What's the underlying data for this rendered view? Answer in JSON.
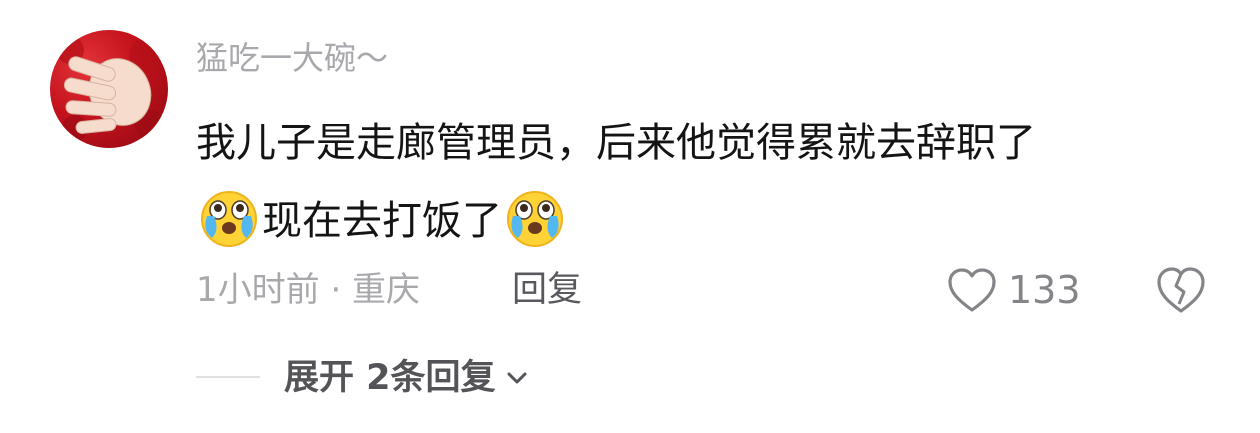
{
  "comment": {
    "username": "猛吃一大碗～",
    "text_line1": "我儿子是走廊管理员，后来他觉得累就去辞职了",
    "text_line2": "现在去打饭了",
    "emoji_icon": "crying-face-emoji",
    "time_location": "1小时前 · 重庆",
    "reply_label": "回复",
    "like_count": "133",
    "expand_label": "展开 2条回复"
  },
  "colors": {
    "username": "#a9a9ad",
    "text": "#141414",
    "meta": "#a9a9ad",
    "reply": "#58585e",
    "avatar": "#c4121c"
  }
}
